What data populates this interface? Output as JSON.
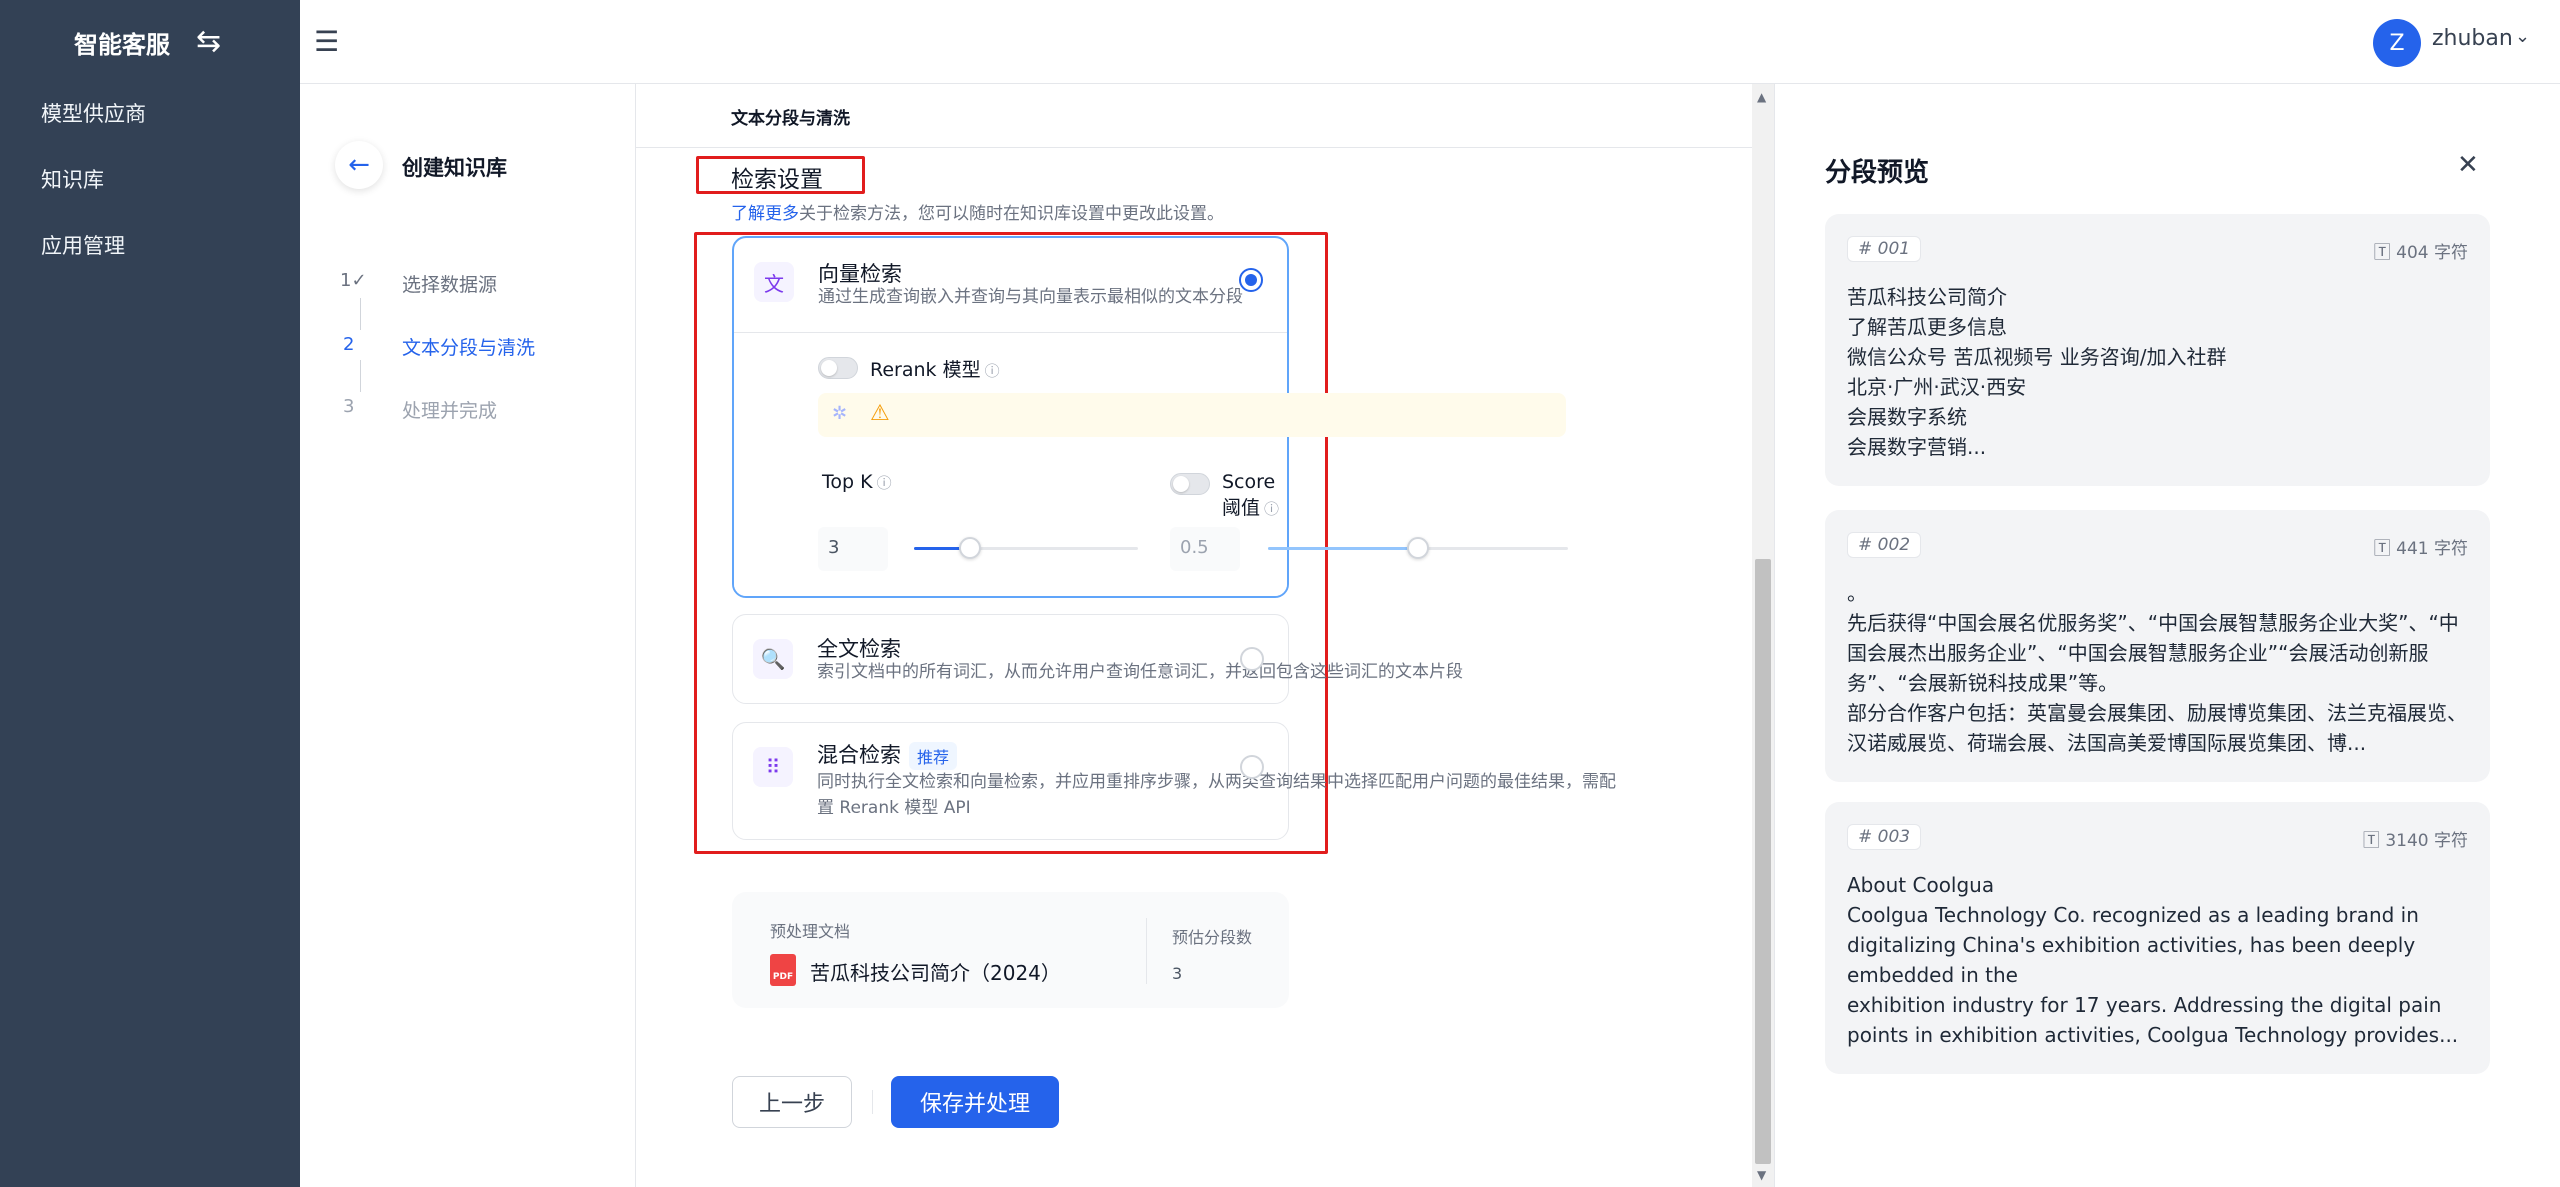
{
  "app": {
    "title": "智能客服"
  },
  "sidebar": {
    "items": [
      {
        "label": "模型供应商"
      },
      {
        "label": "知识库"
      },
      {
        "label": "应用管理"
      }
    ]
  },
  "user": {
    "initial": "Z",
    "name": "zhuban"
  },
  "steps": {
    "title": "创建知识库",
    "items": [
      {
        "num": "1✓",
        "label": "选择数据源"
      },
      {
        "num": "2",
        "label": "文本分段与清洗"
      },
      {
        "num": "3",
        "label": "处理并完成"
      }
    ]
  },
  "main": {
    "crumb": "文本分段与清洗",
    "section_title": "检索设置",
    "learn_more": "了解更多",
    "section_desc": "关于检索方法，您可以随时在知识库设置中更改此设置。",
    "vector": {
      "title": "向量检索",
      "desc": "通过生成查询嵌入并查询与其向量表示最相似的文本分段",
      "rerank_label": "Rerank 模型",
      "topk_label": "Top K",
      "topk_value": "3",
      "topk_fraction": 0.25,
      "score_label": "Score 阈值",
      "score_value": "0.5",
      "score_fraction": 0.5
    },
    "fulltext": {
      "title": "全文检索",
      "desc": "索引文档中的所有词汇，从而允许用户查询任意词汇，并返回包含这些词汇的文本片段"
    },
    "hybrid": {
      "title": "混合检索",
      "badge": "推荐",
      "desc": "同时执行全文检索和向量检索，并应用重排序步骤，从两类查询结果中选择匹配用户问题的最佳结果，需配置 Rerank 模型 API"
    },
    "summary": {
      "doc_label": "预处理文档",
      "pdf_label": "PDF",
      "doc_name": "苦瓜科技公司简介（2024）",
      "count_label": "预估分段数",
      "count_value": "3"
    },
    "buttons": {
      "prev": "上一步",
      "save": "保存并处理"
    }
  },
  "preview": {
    "title": "分段预览",
    "segments": [
      {
        "id": "# 001",
        "count": "404 字符",
        "text": "苦瓜科技公司简介\n了解苦瓜更多信息\n微信公众号 苦瓜视频号 业务咨询/加入社群\n北京·广州·武汉·西安\n会展数字系统\n会展数字营销..."
      },
      {
        "id": "# 002",
        "count": "441 字符",
        "text": "。\n先后获得“中国会展名优服务奖”、“中国会展智慧服务企业大奖”、“中国会展杰出服务企业”、“中国会展智慧服务企业”“会展活动创新服务”、“会展新锐科技成果”等。\n部分合作客户包括：英富曼会展集团、励展博览集团、法兰克福展览、汉诺威展览、荷瑞会展、法国高美爱博国际展览集团、博..."
      },
      {
        "id": "# 003",
        "count": "3140 字符",
        "text": "About Coolgua\nCoolgua Technology Co. recognized as a leading brand in digitalizing China's exhibition activities, has been deeply embedded in the\nexhibition industry for 17 years. Addressing the digital pain points in exhibition activities, Coolgua Technology provides..."
      }
    ]
  }
}
